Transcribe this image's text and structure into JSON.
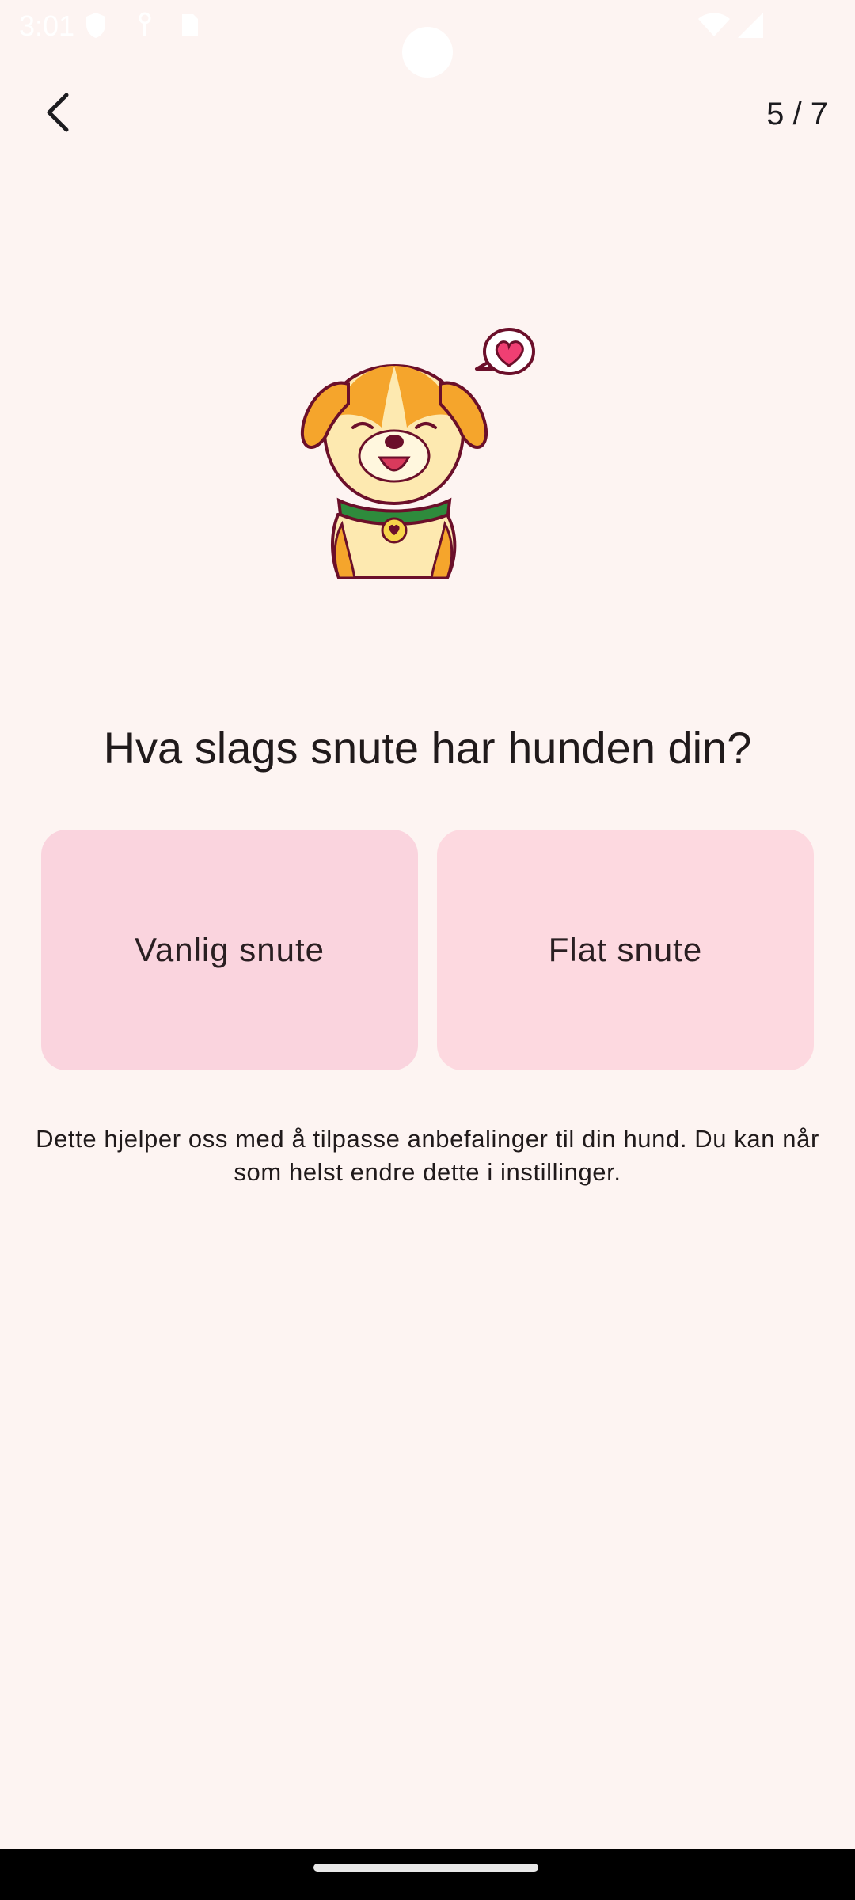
{
  "status_bar": {
    "time": "3:01",
    "icons": [
      "shield-icon",
      "vpn-key-icon",
      "sim-card-icon",
      "wifi-icon",
      "signal-icon"
    ]
  },
  "header": {
    "back_icon": "chevron-left-icon",
    "progress": "5 / 7"
  },
  "illustration": {
    "subject": "dog-with-heart-icon"
  },
  "main": {
    "question": "Hva slags snute har hunden din?",
    "options": [
      {
        "label": "Vanlig snute"
      },
      {
        "label": "Flat snute"
      }
    ],
    "help_text": "Dette hjelper oss med å tilpasse anbefalinger til din hund. Du kan når som helst endre dette i instillinger."
  },
  "colors": {
    "background": "#fdf4f2",
    "option_card": "#fad4de",
    "text": "#201a1b"
  }
}
